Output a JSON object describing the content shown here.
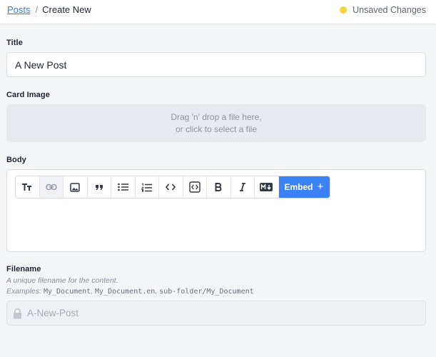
{
  "breadcrumb": {
    "parent": "Posts",
    "separator": "/",
    "current": "Create New"
  },
  "status": {
    "text": "Unsaved Changes",
    "color": "#f2d63b"
  },
  "title_field": {
    "label": "Title",
    "value": "A New Post"
  },
  "card_image": {
    "label": "Card Image",
    "line1": "Drag 'n' drop a file here,",
    "line2": "or click to select a file"
  },
  "body_field": {
    "label": "Body",
    "toolbar": {
      "buttons": [
        {
          "name": "heading",
          "icon": "text-size-icon"
        },
        {
          "name": "link",
          "icon": "link-icon"
        },
        {
          "name": "image",
          "icon": "image-icon"
        },
        {
          "name": "quote",
          "icon": "quote-icon"
        },
        {
          "name": "bullet-list",
          "icon": "bullet-list-icon"
        },
        {
          "name": "numbered-list",
          "icon": "numbered-list-icon"
        },
        {
          "name": "code",
          "icon": "code-icon"
        },
        {
          "name": "code-block",
          "icon": "code-block-icon"
        },
        {
          "name": "bold",
          "icon": "bold-icon"
        },
        {
          "name": "italic",
          "icon": "italic-icon"
        },
        {
          "name": "markdown",
          "icon": "markdown-icon"
        }
      ],
      "embed_label": "Embed",
      "embed_symbol": "+",
      "accent": "#3b82f6"
    }
  },
  "filename_field": {
    "label": "Filename",
    "help_line1": "A unique filename for the content.",
    "examples_prefix": "Examples:",
    "examples": [
      "My_Document",
      "My_Document.en",
      "sub-folder/My_Document"
    ],
    "value": "A-New-Post"
  }
}
